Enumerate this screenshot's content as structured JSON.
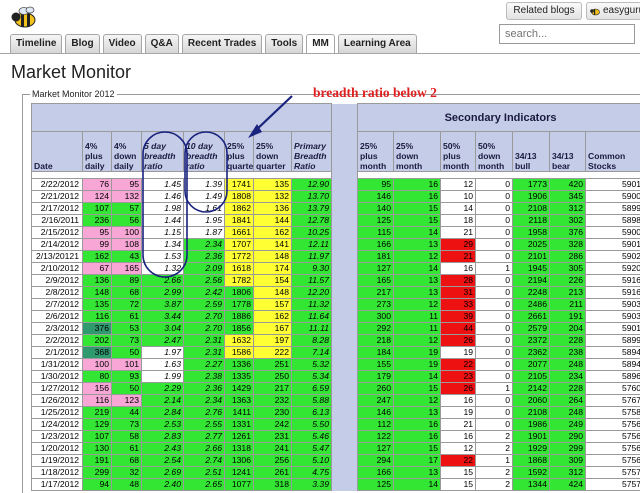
{
  "header": {
    "related_label": "Related blogs",
    "user_label": "easyguru"
  },
  "tabs": [
    "Timeline",
    "Blog",
    "Video",
    "Q&A",
    "Recent Trades",
    "Tools",
    "MM",
    "Learning Area"
  ],
  "active_tab": "MM",
  "search": {
    "placeholder": "search..."
  },
  "page_title": "Market Monitor",
  "frame_legend": "Market Monitor 2012",
  "annotation": "breadth ratio below 2",
  "colors": {
    "green": "#33e633",
    "pink": "#f7a6d6",
    "yellow": "#ffff33",
    "dark_green": "#2f9a6e",
    "red": "#ee1111",
    "header_blue": "#c5cce7",
    "annotation_red": "#e02020",
    "circle_blue": "#1a237e"
  },
  "table": {
    "secondary_title": "Secondary Indicators",
    "headers": [
      "Date",
      "4% plus daily",
      "4% down daily",
      "5 day breadth ratio",
      "10 day breadth ratio",
      "25% plus quarter",
      "25% down quarter",
      "Primary Breadth Ratio",
      "",
      "25% plus month",
      "25% down month",
      "50% plus month",
      "50% down month",
      "34/13 bull",
      "34/13 bear",
      "Common Stocks"
    ],
    "rows": [
      [
        "2/22/2012",
        "76",
        "95",
        "1.45",
        "1.39",
        "1741",
        "135",
        "12.90",
        "",
        "95",
        "16",
        "12",
        "0",
        "1773",
        "420",
        "5901"
      ],
      [
        "2/21/2012",
        "124",
        "132",
        "1.46",
        "1.49",
        "1808",
        "132",
        "13.70",
        "",
        "146",
        "16",
        "10",
        "0",
        "1906",
        "345",
        "5900"
      ],
      [
        "2/17/2012",
        "107",
        "57",
        "1.98",
        "1.61",
        "1862",
        "136",
        "13.79",
        "",
        "140",
        "15",
        "14",
        "0",
        "2108",
        "312",
        "5899"
      ],
      [
        "2/16/2011",
        "236",
        "56",
        "1.44",
        "1.95",
        "1841",
        "144",
        "12.78",
        "",
        "125",
        "15",
        "18",
        "0",
        "2118",
        "302",
        "5898"
      ],
      [
        "2/15/2012",
        "95",
        "100",
        "1.15",
        "1.87",
        "1661",
        "162",
        "10.25",
        "",
        "115",
        "14",
        "21",
        "0",
        "1958",
        "376",
        "5900"
      ],
      [
        "2/14/2012",
        "99",
        "108",
        "1.34",
        "2.34",
        "1707",
        "141",
        "12.11",
        "",
        "166",
        "13",
        "29",
        "0",
        "2025",
        "328",
        "5901"
      ],
      [
        "2/13/20121",
        "162",
        "43",
        "1.53",
        "2.36",
        "1772",
        "148",
        "11.97",
        "",
        "181",
        "12",
        "21",
        "0",
        "2101",
        "286",
        "5902"
      ],
      [
        "2/10/2012",
        "67",
        "165",
        "1.32",
        "2.09",
        "1618",
        "174",
        "9.30",
        "",
        "127",
        "14",
        "16",
        "1",
        "1945",
        "305",
        "5920"
      ],
      [
        "2/9/2012",
        "136",
        "89",
        "2.66",
        "2.56",
        "1782",
        "154",
        "11.57",
        "",
        "165",
        "13",
        "28",
        "0",
        "2194",
        "226",
        "5916"
      ],
      [
        "2/8/2012",
        "148",
        "68",
        "2.99",
        "2.42",
        "1806",
        "148",
        "12.20",
        "",
        "217",
        "13",
        "31",
        "0",
        "2248",
        "213",
        "5916"
      ],
      [
        "2/7/2012",
        "135",
        "72",
        "3.87",
        "2.59",
        "1778",
        "157",
        "11.32",
        "",
        "273",
        "12",
        "33",
        "0",
        "2486",
        "211",
        "5903"
      ],
      [
        "2/6/2012",
        "116",
        "61",
        "3.44",
        "2.70",
        "1886",
        "162",
        "11.64",
        "",
        "300",
        "11",
        "39",
        "0",
        "2661",
        "191",
        "5903"
      ],
      [
        "2/3/2012",
        "376",
        "53",
        "3.04",
        "2.70",
        "1856",
        "167",
        "11.11",
        "",
        "292",
        "11",
        "44",
        "0",
        "2579",
        "204",
        "5901"
      ],
      [
        "2/2/2012",
        "202",
        "73",
        "2.47",
        "2.31",
        "1632",
        "197",
        "8.28",
        "",
        "218",
        "12",
        "26",
        "0",
        "2372",
        "228",
        "5899"
      ],
      [
        "2/1/2012",
        "368",
        "50",
        "1.97",
        "2.31",
        "1586",
        "222",
        "7.14",
        "",
        "184",
        "19",
        "19",
        "0",
        "2362",
        "238",
        "5894"
      ],
      [
        "1/31/2012",
        "100",
        "101",
        "1.63",
        "2.27",
        "1336",
        "251",
        "5.32",
        "",
        "155",
        "19",
        "22",
        "0",
        "2077",
        "248",
        "5894"
      ],
      [
        "1/30/2012",
        "80",
        "93",
        "1.99",
        "2.38",
        "1335",
        "250",
        "5.34",
        "",
        "179",
        "14",
        "23",
        "0",
        "2105",
        "234",
        "5896"
      ],
      [
        "1/27/2012",
        "156",
        "50",
        "2.29",
        "2.36",
        "1429",
        "217",
        "6.59",
        "",
        "260",
        "15",
        "26",
        "1",
        "2142",
        "228",
        "5760"
      ],
      [
        "1/26/2012",
        "116",
        "123",
        "2.14",
        "2.34",
        "1363",
        "232",
        "5.88",
        "",
        "247",
        "12",
        "16",
        "0",
        "2060",
        "264",
        "5767"
      ],
      [
        "1/25/2012",
        "219",
        "44",
        "2.84",
        "2.76",
        "1411",
        "230",
        "6.13",
        "",
        "146",
        "13",
        "19",
        "0",
        "2108",
        "248",
        "5758"
      ],
      [
        "1/24/2012",
        "129",
        "73",
        "2.53",
        "2.55",
        "1331",
        "242",
        "5.50",
        "",
        "112",
        "16",
        "21",
        "0",
        "1986",
        "249",
        "5756"
      ],
      [
        "1/23/2012",
        "107",
        "58",
        "2.83",
        "2.77",
        "1261",
        "231",
        "5.46",
        "",
        "122",
        "16",
        "16",
        "2",
        "1901",
        "290",
        "5756"
      ],
      [
        "1/20/2012",
        "130",
        "61",
        "2.43",
        "2.66",
        "1318",
        "241",
        "5.47",
        "",
        "127",
        "15",
        "12",
        "2",
        "1929",
        "299",
        "5756"
      ],
      [
        "1/19/2012",
        "191",
        "68",
        "2.54",
        "2.74",
        "1306",
        "256",
        "5.10",
        "",
        "294",
        "17",
        "22",
        "1",
        "1868",
        "309",
        "5756"
      ],
      [
        "1/18/2012",
        "299",
        "32",
        "2.69",
        "2.51",
        "1241",
        "261",
        "4.75",
        "",
        "166",
        "13",
        "15",
        "2",
        "1592",
        "312",
        "5757"
      ],
      [
        "1/17/2012",
        "94",
        "48",
        "2.40",
        "2.65",
        "1077",
        "318",
        "3.39",
        "",
        "125",
        "14",
        "15",
        "2",
        "1344",
        "424",
        "5757"
      ]
    ],
    "row_colors": [
      [
        "w",
        "p",
        "p",
        "w",
        "w",
        "y",
        "y",
        "g",
        "",
        "g",
        "g",
        "w",
        "w",
        "g",
        "g",
        "w"
      ],
      [
        "w",
        "p",
        "p",
        "w",
        "w",
        "y",
        "y",
        "g",
        "",
        "g",
        "g",
        "w",
        "w",
        "g",
        "g",
        "w"
      ],
      [
        "w",
        "g",
        "g",
        "w",
        "w",
        "y",
        "y",
        "g",
        "",
        "g",
        "g",
        "w",
        "w",
        "g",
        "g",
        "w"
      ],
      [
        "w",
        "g",
        "g",
        "w",
        "w",
        "y",
        "y",
        "g",
        "",
        "g",
        "g",
        "w",
        "w",
        "g",
        "g",
        "w"
      ],
      [
        "w",
        "p",
        "p",
        "w",
        "w",
        "y",
        "y",
        "g",
        "",
        "g",
        "g",
        "w",
        "w",
        "g",
        "g",
        "w"
      ],
      [
        "w",
        "p",
        "p",
        "w",
        "g",
        "y",
        "y",
        "g",
        "",
        "g",
        "g",
        "r",
        "w",
        "g",
        "g",
        "w"
      ],
      [
        "w",
        "g",
        "g",
        "w",
        "g",
        "y",
        "y",
        "g",
        "",
        "g",
        "g",
        "r",
        "w",
        "g",
        "g",
        "w"
      ],
      [
        "w",
        "p",
        "p",
        "w",
        "g",
        "y",
        "y",
        "g",
        "",
        "g",
        "g",
        "w",
        "w",
        "g",
        "g",
        "w"
      ],
      [
        "w",
        "g",
        "g",
        "g",
        "g",
        "y",
        "y",
        "g",
        "",
        "g",
        "g",
        "r",
        "w",
        "g",
        "g",
        "w"
      ],
      [
        "w",
        "g",
        "g",
        "g",
        "g",
        "g",
        "y",
        "g",
        "",
        "g",
        "g",
        "r",
        "w",
        "g",
        "g",
        "w"
      ],
      [
        "w",
        "g",
        "g",
        "g",
        "g",
        "g",
        "y",
        "g",
        "",
        "g",
        "g",
        "r",
        "w",
        "g",
        "g",
        "w"
      ],
      [
        "w",
        "g",
        "g",
        "g",
        "g",
        "g",
        "y",
        "g",
        "",
        "g",
        "g",
        "r",
        "w",
        "g",
        "g",
        "w"
      ],
      [
        "w",
        "d",
        "g",
        "g",
        "g",
        "g",
        "y",
        "g",
        "",
        "g",
        "g",
        "r",
        "w",
        "g",
        "g",
        "w"
      ],
      [
        "w",
        "g",
        "g",
        "g",
        "g",
        "y",
        "y",
        "g",
        "",
        "g",
        "g",
        "r",
        "w",
        "g",
        "g",
        "w"
      ],
      [
        "w",
        "d",
        "g",
        "w",
        "g",
        "y",
        "y",
        "g",
        "",
        "g",
        "g",
        "w",
        "w",
        "g",
        "g",
        "w"
      ],
      [
        "w",
        "p",
        "p",
        "w",
        "g",
        "g",
        "g",
        "g",
        "",
        "g",
        "g",
        "r",
        "w",
        "g",
        "g",
        "w"
      ],
      [
        "w",
        "g",
        "g",
        "w",
        "g",
        "g",
        "g",
        "g",
        "",
        "g",
        "g",
        "r",
        "w",
        "g",
        "g",
        "w"
      ],
      [
        "w",
        "p",
        "g",
        "g",
        "g",
        "g",
        "g",
        "g",
        "",
        "g",
        "g",
        "r",
        "w",
        "g",
        "g",
        "w"
      ],
      [
        "w",
        "p",
        "p",
        "g",
        "g",
        "g",
        "g",
        "g",
        "",
        "g",
        "g",
        "w",
        "w",
        "g",
        "g",
        "w"
      ],
      [
        "w",
        "g",
        "g",
        "g",
        "g",
        "g",
        "g",
        "g",
        "",
        "g",
        "g",
        "w",
        "w",
        "g",
        "g",
        "w"
      ],
      [
        "w",
        "g",
        "g",
        "g",
        "g",
        "g",
        "g",
        "g",
        "",
        "g",
        "g",
        "w",
        "w",
        "g",
        "g",
        "w"
      ],
      [
        "w",
        "g",
        "g",
        "g",
        "g",
        "g",
        "g",
        "g",
        "",
        "g",
        "g",
        "w",
        "w",
        "g",
        "g",
        "w"
      ],
      [
        "w",
        "g",
        "g",
        "g",
        "g",
        "g",
        "g",
        "g",
        "",
        "g",
        "g",
        "w",
        "w",
        "g",
        "g",
        "w"
      ],
      [
        "w",
        "g",
        "g",
        "g",
        "g",
        "g",
        "g",
        "g",
        "",
        "g",
        "g",
        "r",
        "w",
        "g",
        "g",
        "w"
      ],
      [
        "w",
        "g",
        "g",
        "g",
        "g",
        "g",
        "g",
        "g",
        "",
        "g",
        "g",
        "w",
        "w",
        "g",
        "g",
        "w"
      ],
      [
        "w",
        "g",
        "g",
        "g",
        "g",
        "g",
        "g",
        "g",
        "",
        "g",
        "g",
        "w",
        "w",
        "g",
        "g",
        "w"
      ]
    ]
  }
}
